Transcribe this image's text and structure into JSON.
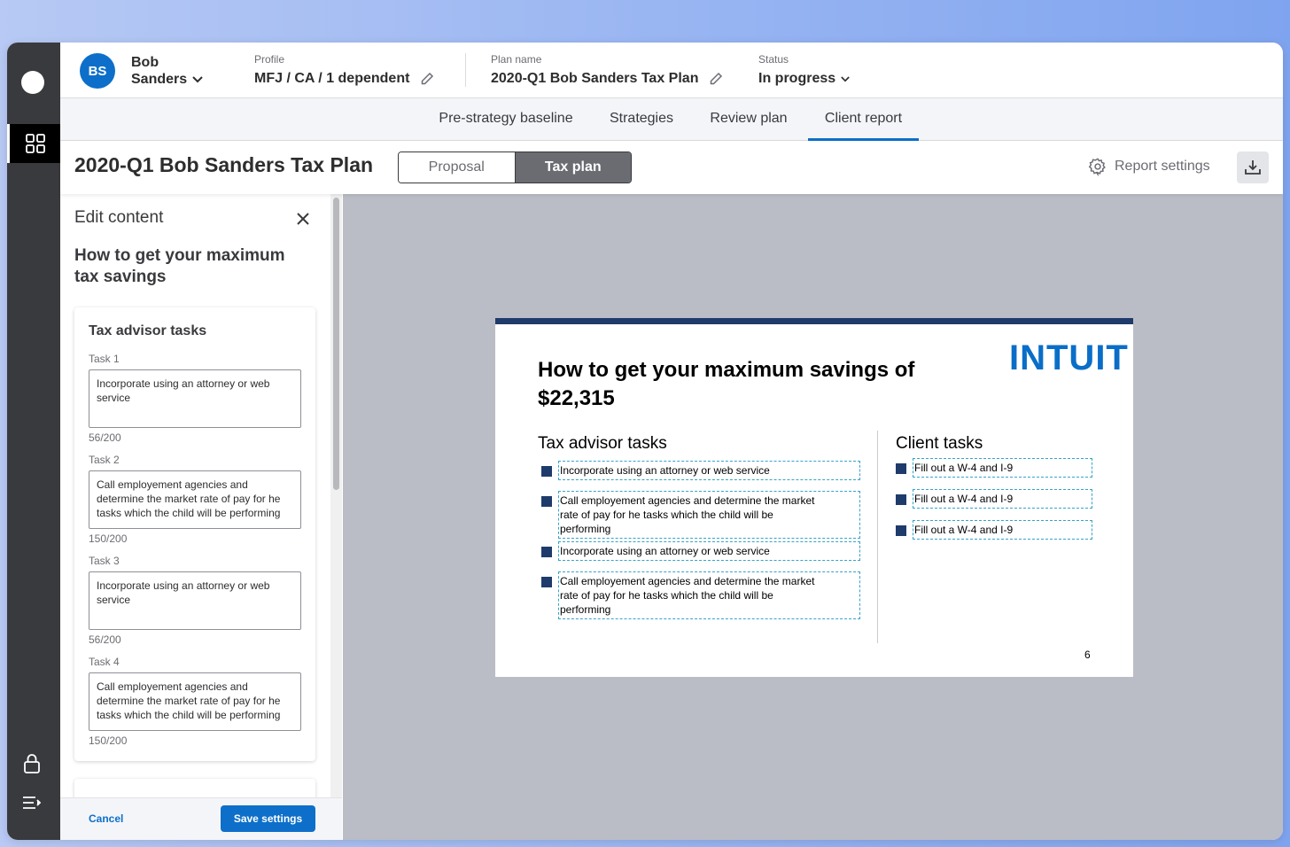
{
  "rail": {
    "icons": [
      "app-logo",
      "dashboard-icon",
      "lock-icon",
      "menu-icon"
    ]
  },
  "header": {
    "avatar_initials": "BS",
    "client_first": "Bob",
    "client_last": "Sanders",
    "profile_label": "Profile",
    "profile_value": "MFJ / CA / 1 dependent",
    "plan_label": "Plan name",
    "plan_value": "2020-Q1 Bob Sanders Tax Plan",
    "status_label": "Status",
    "status_value": "In progress"
  },
  "tabs": [
    {
      "label": "Pre-strategy baseline"
    },
    {
      "label": "Strategies"
    },
    {
      "label": "Review plan"
    },
    {
      "label": "Client report"
    }
  ],
  "titlebar": {
    "title": "2020-Q1 Bob Sanders Tax Plan",
    "seg_off": "Proposal",
    "seg_on": "Tax plan",
    "report_settings": "Report settings"
  },
  "panel": {
    "heading": "Edit content",
    "subtitle": "How to get your maximum tax savings",
    "card_title": "Tax advisor tasks",
    "tasks": [
      {
        "label": "Task 1",
        "text": "Incorporate using an attorney or web service",
        "count": "56/200"
      },
      {
        "label": "Task 2",
        "text": "Call employement agencies and determine the market rate of pay for he tasks which the child will be performing",
        "count": "150/200"
      },
      {
        "label": "Task 3",
        "text": "Incorporate using an attorney or web service",
        "count": "56/200"
      },
      {
        "label": "Task 4",
        "text": "Call employement agencies and determine the market rate of pay for he tasks which the child will be performing",
        "count": "150/200"
      }
    ],
    "cancel": "Cancel",
    "save": "Save settings"
  },
  "slide": {
    "title": "How to get your maximum savings of $22,315",
    "logo": "INTUIT",
    "advisor_title": "Tax advisor tasks",
    "advisor_tasks": [
      "Incorporate using an attorney or web service",
      "Call employement agencies and determine the market rate of pay for he tasks which the child will be performing",
      "Incorporate using an attorney or web service",
      "Call employement agencies and determine the market rate of pay for he tasks which the child will be performing"
    ],
    "client_title": "Client tasks",
    "client_tasks": [
      "Fill out a W-4 and I-9",
      "Fill out a W-4 and I-9",
      "Fill out a W-4 and I-9"
    ],
    "page_number": "6"
  },
  "colors": {
    "brand_blue": "#0d6fc9",
    "rail_dark": "#393a3d",
    "slide_navy": "#1e3b6b",
    "preview_bg": "#babdc5"
  }
}
